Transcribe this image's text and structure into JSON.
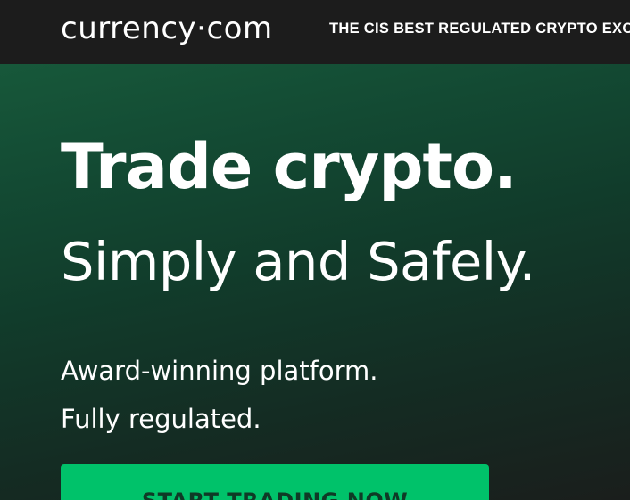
{
  "header": {
    "logo_text": "currency·com",
    "tagline": "THE CIS BEST REGULATED CRYPTO EXCHANGE"
  },
  "hero": {
    "headline": "Trade crypto.",
    "subheadline": "Simply and Safely.",
    "features": [
      "Award-winning platform.",
      "Fully regulated."
    ],
    "cta_label": "START TRADING NOW"
  },
  "colors": {
    "header_bg": "#1c1c1c",
    "hero_green": "#17583a",
    "cta_green": "#00c26a",
    "text": "#ffffff"
  }
}
